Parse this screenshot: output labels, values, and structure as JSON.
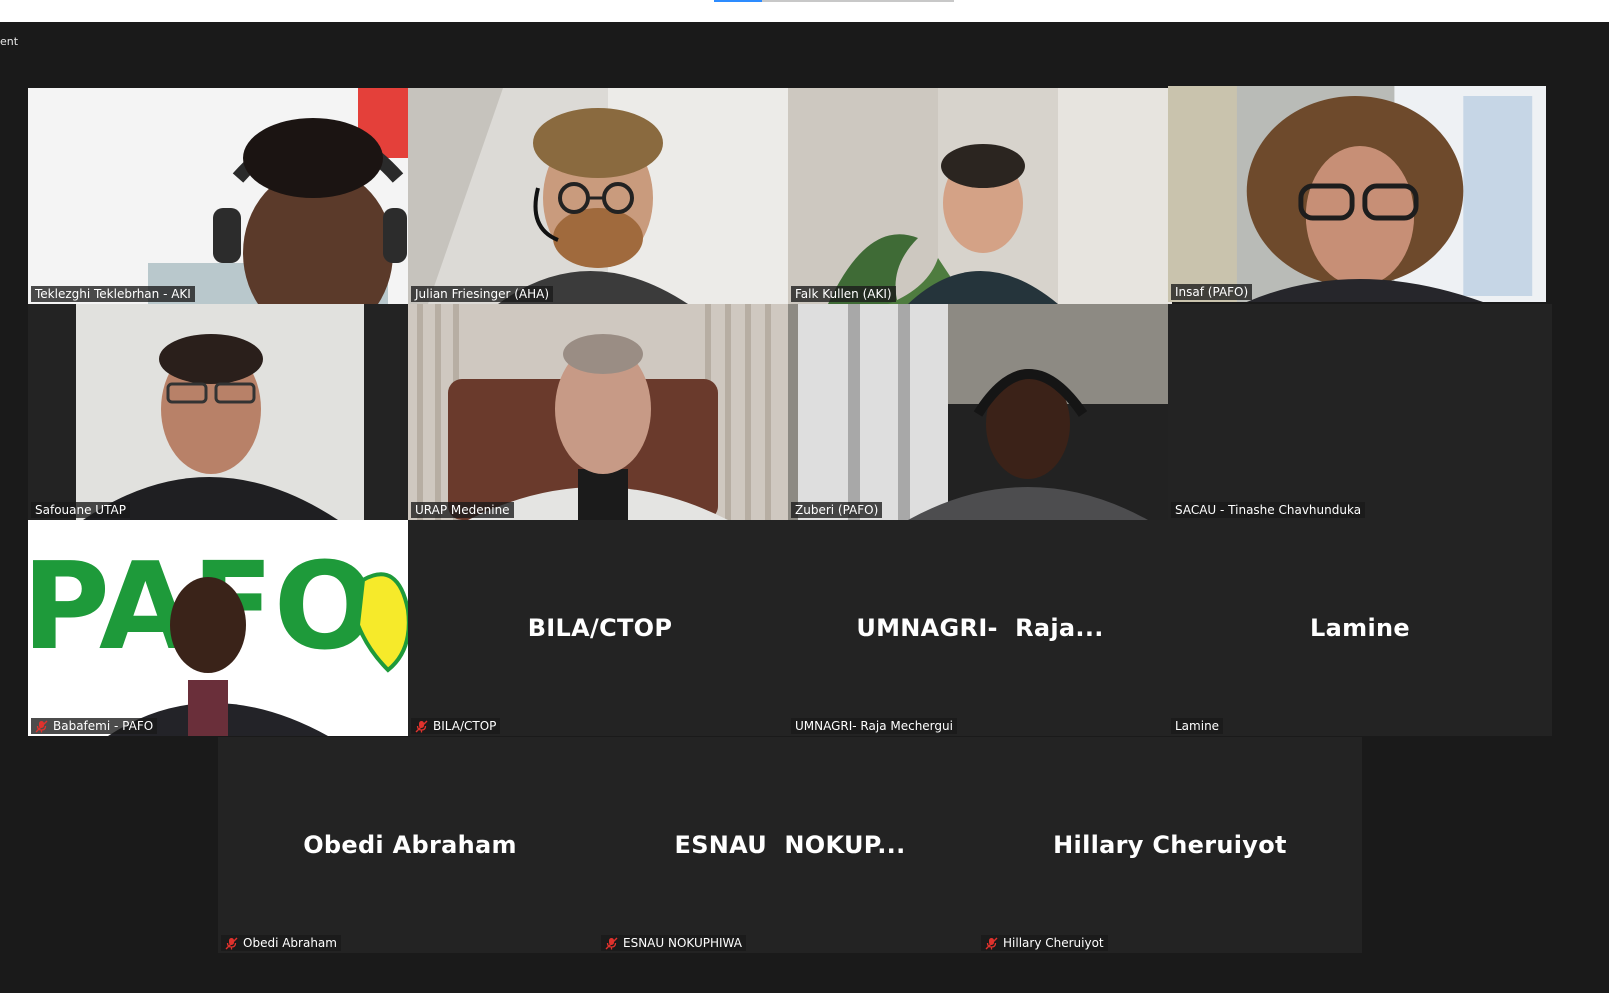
{
  "window": {
    "title_fragment": "ent"
  },
  "colors": {
    "background": "#1a1a1a",
    "tile": "#232323",
    "active_speaker": "#d9f255",
    "mute": "#e0322d"
  },
  "participants": [
    {
      "label": "Teklezghi Teklebrhan - AKI",
      "video": true,
      "muted": false
    },
    {
      "label": "Julian Friesinger (AHA)",
      "video": true,
      "muted": false
    },
    {
      "label": "Falk Kullen (AKI)",
      "video": true,
      "muted": false
    },
    {
      "label": "Insaf (PAFO)",
      "video": true,
      "muted": false,
      "active": true
    },
    {
      "label": "Safouane UTAP",
      "video": true,
      "muted": false
    },
    {
      "label": "URAP Medenine",
      "video": true,
      "muted": false
    },
    {
      "label": "Zuberi (PAFO)",
      "video": true,
      "muted": false
    },
    {
      "label": "SACAU - Tinashe Chavhunduka",
      "video": false,
      "muted": false
    },
    {
      "label": "Babafemi - PAFO",
      "video": true,
      "muted": true,
      "background_logo": "PAFO"
    },
    {
      "label": "BILA/CTOP",
      "display_name": "BILA/CTOP",
      "video": false,
      "muted": true
    },
    {
      "label": "UMNAGRI- Raja Mechergui",
      "display_name": "UMNAGRI-  Raja...",
      "video": false,
      "muted": false
    },
    {
      "label": "Lamine",
      "display_name": "Lamine",
      "video": false,
      "muted": false
    },
    {
      "label": "Obedi Abraham",
      "display_name": "Obedi Abraham",
      "video": false,
      "muted": true
    },
    {
      "label": "ESNAU NOKUPHIWA",
      "display_name": "ESNAU  NOKUP...",
      "video": false,
      "muted": true
    },
    {
      "label": "Hillary Cheruiyot",
      "display_name": "Hillary Cheruiyot",
      "video": false,
      "muted": true
    }
  ]
}
